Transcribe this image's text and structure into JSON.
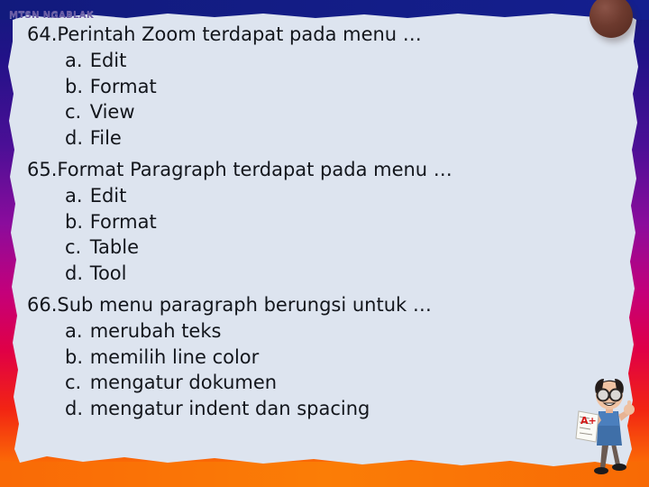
{
  "slide": {
    "background_color": "#dde4ef",
    "header_label": "MTSN NGABLAK",
    "header_color": "#6b5ca5",
    "top_band_color": "#151b7a",
    "bottom_band_color": "#f97306",
    "edge_gradient": [
      "#151b7a",
      "#3c0f8f",
      "#7a0fa0",
      "#c4007a",
      "#e4003a",
      "#f43a10",
      "#ff8000"
    ]
  },
  "questions": [
    {
      "number": "64.",
      "stem": "Perintah Zoom terdapat pada menu …",
      "options": [
        {
          "letter": "a.",
          "text": "Edit"
        },
        {
          "letter": "b.",
          "text": "Format"
        },
        {
          "letter": "c.",
          "text": "View"
        },
        {
          "letter": "d.",
          "text": "File"
        }
      ]
    },
    {
      "number": "65.",
      "stem": "Format Paragraph terdapat pada menu …",
      "options": [
        {
          "letter": "a.",
          "text": "Edit"
        },
        {
          "letter": "b.",
          "text": "Format"
        },
        {
          "letter": "c.",
          "text": "Table"
        },
        {
          "letter": "d.",
          "text": "Tool"
        }
      ]
    },
    {
      "number": "66.",
      "stem": "Sub menu paragraph berungsi untuk …",
      "options": [
        {
          "letter": "a.",
          "text": "merubah teks"
        },
        {
          "letter": "b.",
          "text": "memilih line color"
        },
        {
          "letter": "c.",
          "text": "mengatur dokumen"
        },
        {
          "letter": "d.",
          "text": "mengatur indent dan spacing"
        }
      ]
    }
  ],
  "decorations": {
    "corner_dot": "brown-circle-icon",
    "mascot": "student-thumbs-up-icon",
    "mascot_paper_grade": "A+"
  }
}
